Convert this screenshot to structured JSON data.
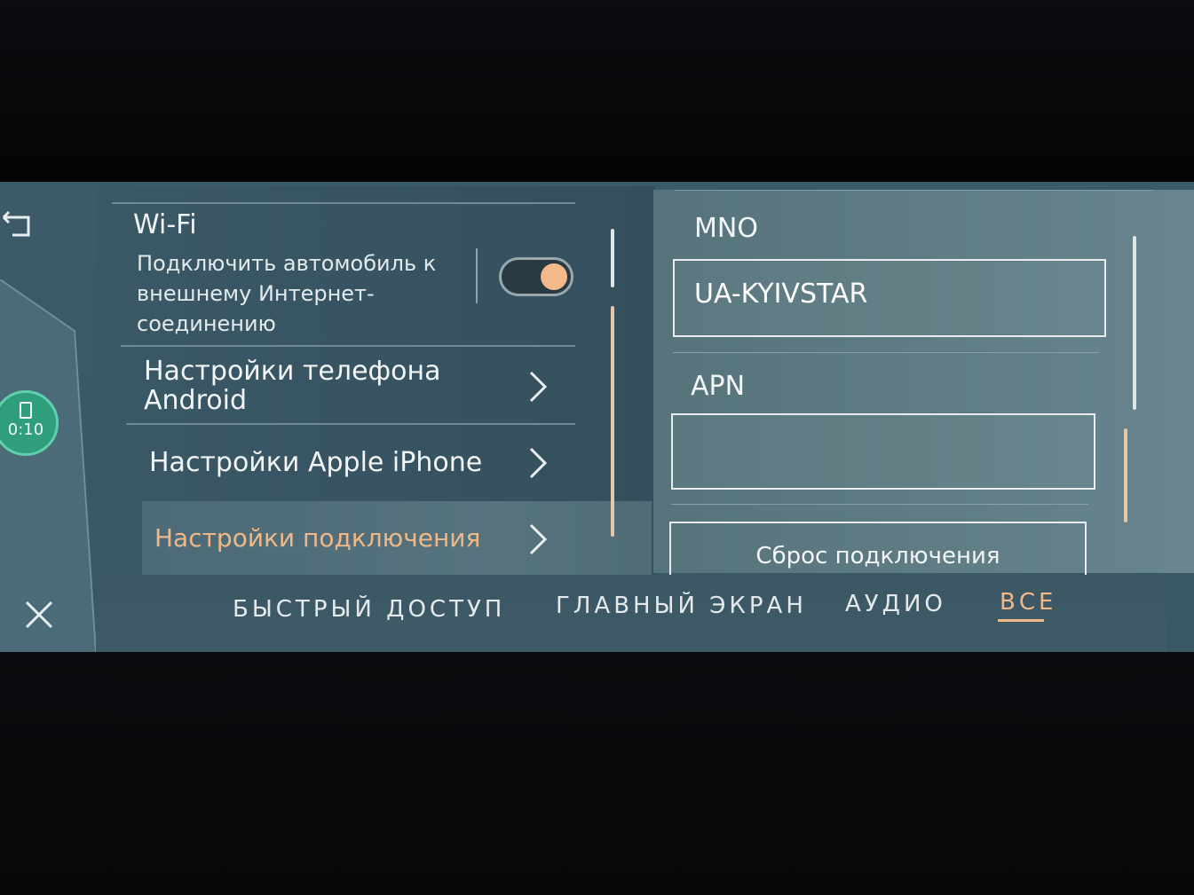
{
  "wifi": {
    "title": "Wi-Fi",
    "description": "Подключить автомобиль к внешнему Интернет-соединению",
    "toggle_on": true
  },
  "phone_badge": {
    "time": "0:10"
  },
  "menu": {
    "android_settings": "Настройки телефона Android",
    "iphone_settings": "Настройки Apple iPhone",
    "connection_settings": "Настройки подключения"
  },
  "connection": {
    "mno_label": "MNO",
    "mno_value": "UA-KYIVSTAR",
    "apn_label": "APN",
    "apn_value": "",
    "reset_label": "Сброс подключения"
  },
  "tabs": [
    {
      "label": "БЫСТРЫЙ ДОСТУП"
    },
    {
      "label": "ГЛАВНЫЙ ЭКРАН"
    },
    {
      "label": "АУДИО"
    },
    {
      "label": "ВСЕ",
      "active": true
    }
  ],
  "colors": {
    "accent": "#f0b887",
    "screen_bg": "#3a5764",
    "right_panel_bg": "#5f7c84",
    "badge_green": "#2f9e7c"
  },
  "icons": {
    "back": "back-arrow-icon",
    "close": "close-icon",
    "phone": "phone-icon",
    "chevron": "chevron-right-icon"
  }
}
